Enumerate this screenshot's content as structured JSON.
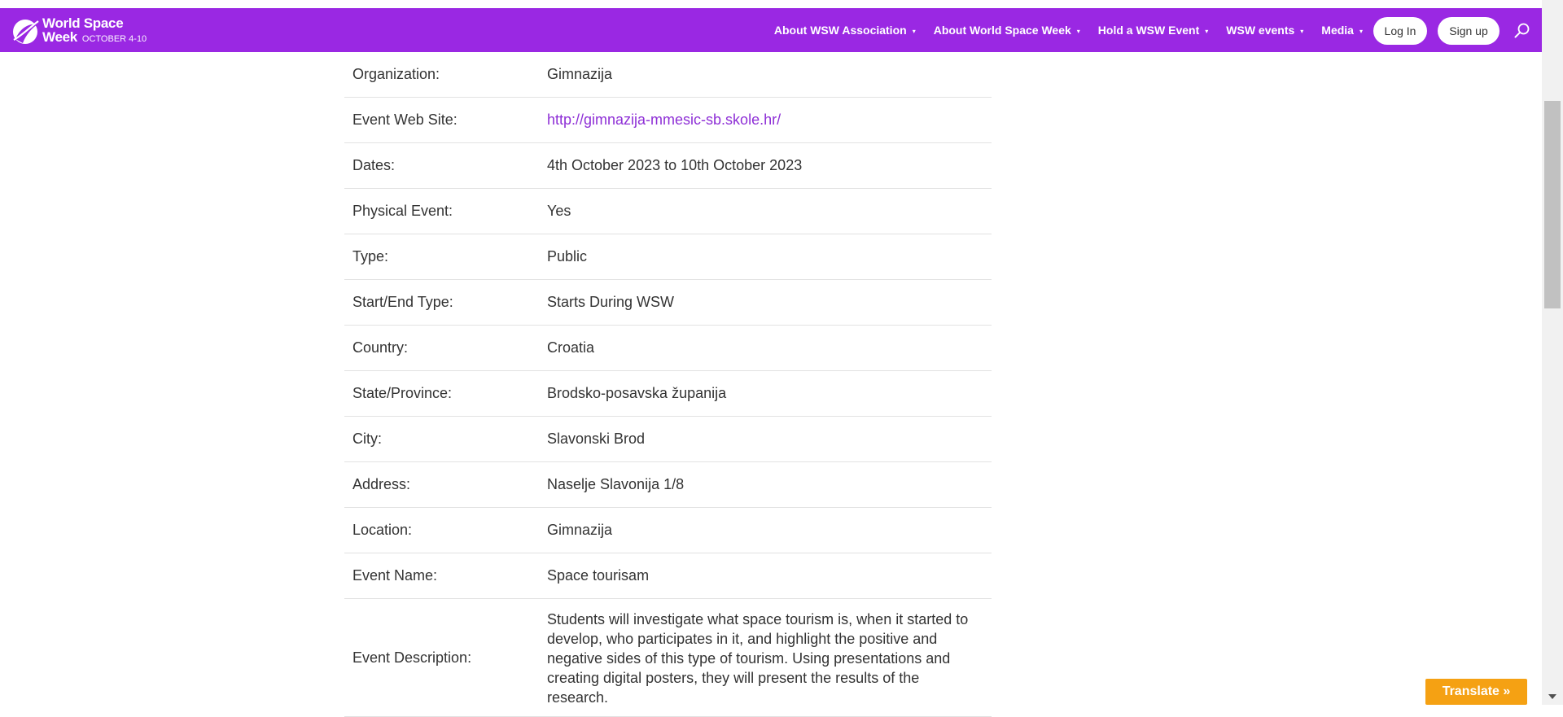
{
  "brand": {
    "line1": "World Space",
    "line2": "Week",
    "subtitle": "OCTOBER 4-10",
    "color": "#9a28e3"
  },
  "nav": {
    "items": [
      {
        "label": "About WSW Association"
      },
      {
        "label": "About World Space Week"
      },
      {
        "label": "Hold a WSW Event"
      },
      {
        "label": "WSW events"
      },
      {
        "label": "Media"
      }
    ],
    "caret": "▾",
    "login_label": "Log In",
    "signup_label": "Sign up",
    "search_icon": "search-icon"
  },
  "event": {
    "rows": [
      {
        "label": "Organization:",
        "value": "Gimnazija"
      },
      {
        "label": "Event Web Site:",
        "value": "http://gimnazija-mmesic-sb.skole.hr/"
      },
      {
        "label": "Dates:",
        "value": "4th October 2023 to 10th October 2023"
      },
      {
        "label": "Physical Event:",
        "value": "Yes"
      },
      {
        "label": "Type:",
        "value": "Public"
      },
      {
        "label": "Start/End Type:",
        "value": "Starts During WSW"
      },
      {
        "label": "Country:",
        "value": "Croatia"
      },
      {
        "label": "State/Province:",
        "value": "Brodsko-posavska županija"
      },
      {
        "label": "City:",
        "value": "Slavonski Brod"
      },
      {
        "label": "Address:",
        "value": "Naselje Slavonija 1/8"
      },
      {
        "label": "Location:",
        "value": "Gimnazija"
      },
      {
        "label": "Event Name:",
        "value": "Space tourisam"
      },
      {
        "label": "Event Description:",
        "value": "Students will investigate what space tourism is, when it started to develop, who participates in it, and highlight the positive and negative sides of this type of tourism. Using presentations and creating digital posters, they will present the results of the research."
      }
    ],
    "link_color": "#8e2fd6"
  },
  "translate": {
    "label": "Translate »",
    "color": "#f5a113"
  }
}
